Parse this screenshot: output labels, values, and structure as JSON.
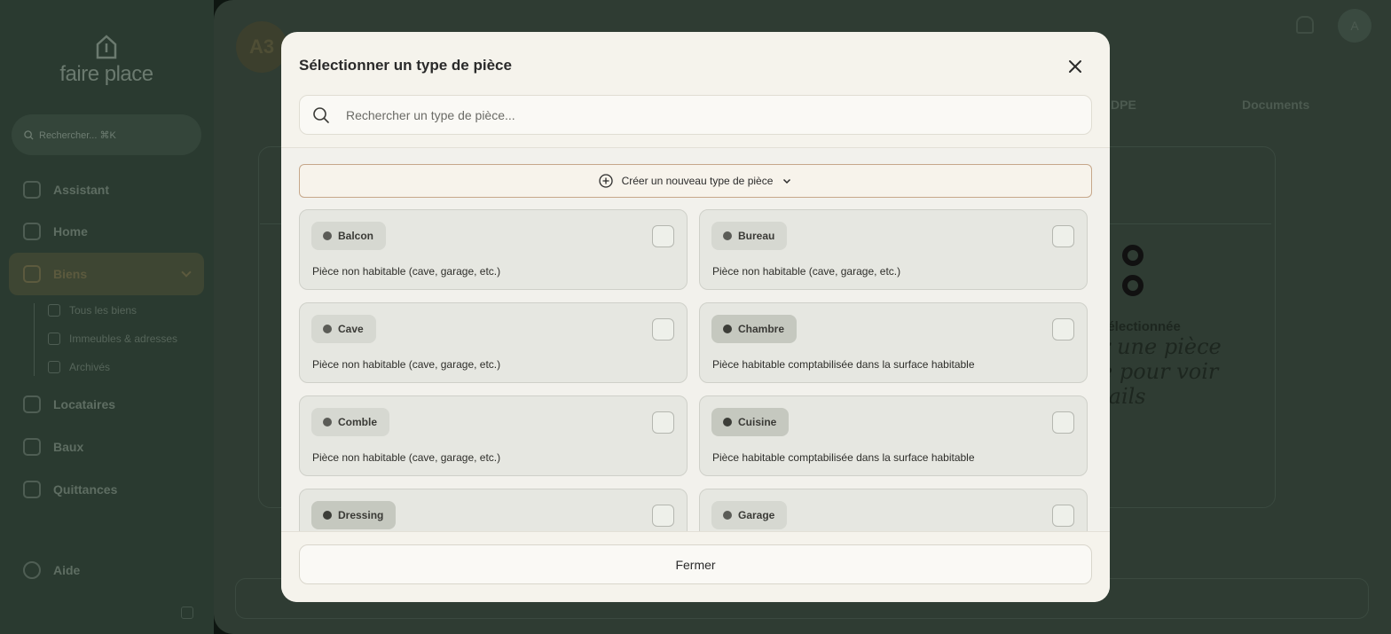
{
  "app": {
    "logo_text": "faire place",
    "search_label": "Rechercher... ⌘K",
    "nav": [
      {
        "label": "Assistant"
      },
      {
        "label": "Home"
      },
      {
        "label": "Biens"
      },
      {
        "label": "Locataires"
      },
      {
        "label": "Baux"
      },
      {
        "label": "Quittances"
      },
      {
        "label": "Aide"
      }
    ],
    "sub_nav": [
      {
        "label": "Tous les biens"
      },
      {
        "label": "Immeubles & adresses"
      },
      {
        "label": "Archivés"
      }
    ],
    "avatar_initials": "A3",
    "user_initial": "A",
    "tabs": [
      {
        "label": "DPE"
      },
      {
        "label": "Documents"
      }
    ],
    "empty_state": {
      "title": "sélectionnée",
      "hint_line1": "r une pièce",
      "hint_line2": "e pour voir",
      "hint_line3": "tails"
    }
  },
  "modal": {
    "title": "Sélectionner un type de pièce",
    "search_placeholder": "Rechercher un type de pièce...",
    "create_label": "Créer un nouveau type de pièce",
    "close_label": "Fermer",
    "room_types": [
      {
        "name": "Balcon",
        "description": "Pièce non habitable (cave, garage, etc.)",
        "habitable": false
      },
      {
        "name": "Bureau",
        "description": "Pièce non habitable (cave, garage, etc.)",
        "habitable": false
      },
      {
        "name": "Cave",
        "description": "Pièce non habitable (cave, garage, etc.)",
        "habitable": false
      },
      {
        "name": "Chambre",
        "description": "Pièce habitable comptabilisée dans la surface habitable",
        "habitable": true
      },
      {
        "name": "Comble",
        "description": "Pièce non habitable (cave, garage, etc.)",
        "habitable": false
      },
      {
        "name": "Cuisine",
        "description": "Pièce habitable comptabilisée dans la surface habitable",
        "habitable": true
      },
      {
        "name": "Dressing",
        "description": "",
        "habitable": true
      },
      {
        "name": "Garage",
        "description": "",
        "habitable": false
      }
    ]
  }
}
